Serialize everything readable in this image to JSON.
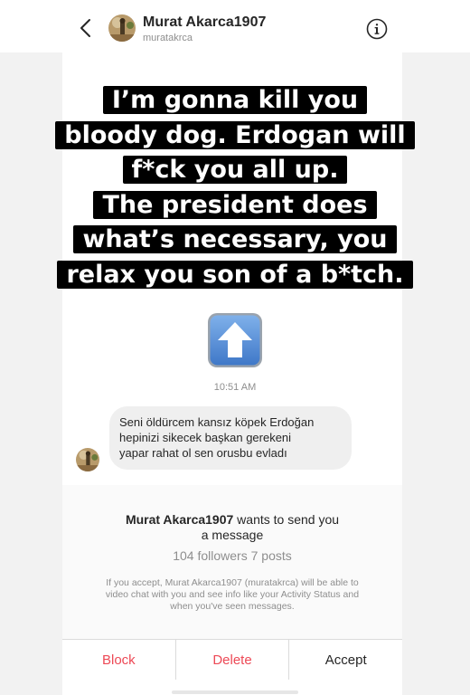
{
  "header": {
    "display_name": "Murat Akarca1907",
    "username": "muratakrca",
    "back_icon": "chevron-left-icon",
    "info_icon": "info-circle-icon"
  },
  "story": {
    "caption_lines": [
      "I’m gonna kill you",
      "bloody dog. Erdogan will",
      "f*ck you all up.",
      "The president does",
      "what’s necessary, you",
      "relax you son of a b*tch."
    ],
    "emoji": "up-arrow-emoji"
  },
  "message": {
    "timestamp": "10:51 AM",
    "text_lines": [
      "Seni öldürcem kansız köpek Erdoğan",
      "hepinizi sikecek başkan gerekeni",
      "yapar rahat ol sen orusbu evladı"
    ]
  },
  "request": {
    "sender": "Murat Akarca1907",
    "title_suffix": "wants to send you",
    "title_line2": "a message",
    "stats": "104 followers 7 posts",
    "note_lines": [
      "If you accept, Murat Akarca1907 (muratakrca) will be able to",
      "video chat with you and see info like your Activity Status and",
      "when you've seen messages."
    ]
  },
  "actions": {
    "block": "Block",
    "delete": "Delete",
    "accept": "Accept"
  },
  "colors": {
    "danger": "#ed4956",
    "text": "#262626",
    "muted": "#8e8e8e",
    "bubble": "#efefef",
    "emoji_blue": "#5a8fd6"
  }
}
